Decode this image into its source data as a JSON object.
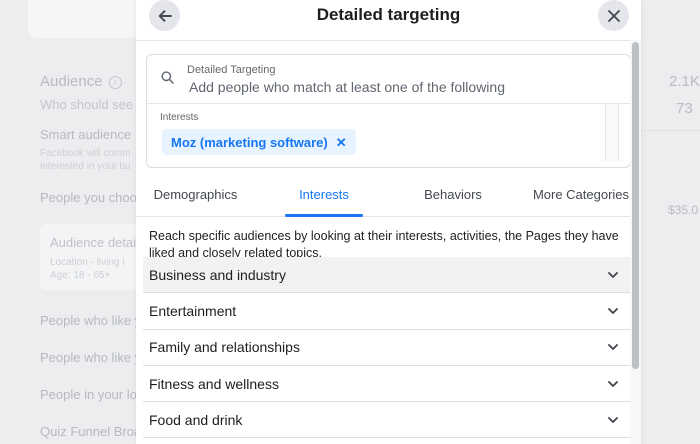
{
  "background": {
    "audience_heading": "Audience",
    "audience_sub": "Who should see",
    "smart_audience": "Smart audience",
    "smart_desc_1": "Facebook will comm",
    "smart_desc_2": "interested in your bu",
    "people_you_choose": "People you choo",
    "audience_details": "Audience detai",
    "location": "Location - living i",
    "age": "Age: 18 - 65+",
    "people_who_like_1": "People who like y",
    "people_who_like_2": "People who like y",
    "people_in_your": "People in your lo",
    "quiz_funnel": "Quiz Funnel Broa",
    "right_num_1": "2.1K",
    "right_num_2": "73",
    "right_amount": "$35.0"
  },
  "modal": {
    "title": "Detailed targeting",
    "search": {
      "label": "Detailed Targeting",
      "placeholder": "Add people who match at least one of the following"
    },
    "interests_label": "Interests",
    "selected_chip": "Moz (marketing software)",
    "tabs": [
      {
        "label": "Demographics",
        "active": false
      },
      {
        "label": "Interests",
        "active": true
      },
      {
        "label": "Behaviors",
        "active": false
      },
      {
        "label": "More Categories",
        "active": false
      }
    ],
    "description": "Reach specific audiences by looking at their interests, activities, the Pages they have liked and closely related topics.",
    "categories": [
      {
        "label": "Business and industry"
      },
      {
        "label": "Entertainment"
      },
      {
        "label": "Family and relationships"
      },
      {
        "label": "Fitness and wellness"
      },
      {
        "label": "Food and drink"
      }
    ]
  },
  "colors": {
    "accent": "#1877f2",
    "chip_bg": "#e7f3ff",
    "hover_row": "#f2f2f2"
  },
  "icons": {
    "back": "arrow-left-icon",
    "close": "close-icon",
    "search": "search-icon",
    "chevron": "chevron-down-icon",
    "remove": "remove-x-icon",
    "info": "info-icon"
  }
}
